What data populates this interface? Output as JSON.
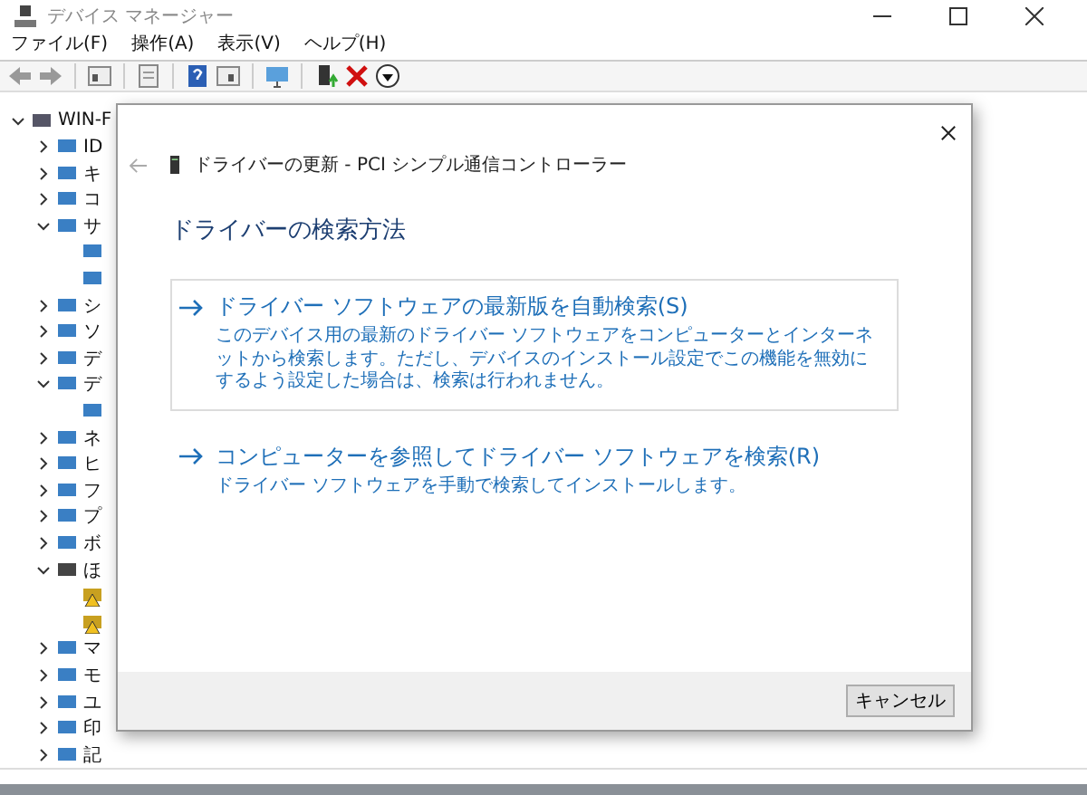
{
  "window": {
    "title": "デバイス マネージャー"
  },
  "menu": [
    "ファイル(F)",
    "操作(A)",
    "表示(V)",
    "ヘルプ(H)"
  ],
  "tree": [
    {
      "label": "WIN-F",
      "kind": "computer",
      "expanded": true,
      "children": [
        {
          "label": "ID",
          "kind": "device",
          "expanded": false
        },
        {
          "label": "キ",
          "kind": "device",
          "expanded": false
        },
        {
          "label": "コ",
          "kind": "device",
          "expanded": false
        },
        {
          "label": "サ",
          "kind": "device",
          "expanded": true,
          "children": [
            {
              "kind": "device"
            },
            {
              "kind": "device"
            }
          ]
        },
        {
          "label": "シ",
          "kind": "device",
          "expanded": false
        },
        {
          "label": "ソ",
          "kind": "device",
          "expanded": false
        },
        {
          "label": "デ",
          "kind": "device",
          "expanded": false
        },
        {
          "label": "デ",
          "kind": "device",
          "expanded": true,
          "children": [
            {
              "kind": "device"
            }
          ]
        },
        {
          "label": "ネ",
          "kind": "device",
          "expanded": false
        },
        {
          "label": "ヒ",
          "kind": "device",
          "expanded": false
        },
        {
          "label": "フ",
          "kind": "device",
          "expanded": false
        },
        {
          "label": "プ",
          "kind": "device",
          "expanded": false
        },
        {
          "label": "ボ",
          "kind": "device",
          "expanded": false
        },
        {
          "label": "ほ",
          "kind": "unknown",
          "expanded": true,
          "children": [
            {
              "kind": "warning"
            },
            {
              "kind": "warning"
            }
          ]
        },
        {
          "label": "マ",
          "kind": "device",
          "expanded": false
        },
        {
          "label": "モ",
          "kind": "device",
          "expanded": false
        },
        {
          "label": "ユ",
          "kind": "device",
          "expanded": false
        },
        {
          "label": "印",
          "kind": "device",
          "expanded": false
        },
        {
          "label": "記",
          "kind": "device",
          "expanded": false
        }
      ]
    }
  ],
  "dialog": {
    "title": "ドライバーの更新 - PCI シンプル通信コントローラー",
    "heading": "ドライバーの検索方法",
    "options": [
      {
        "title": "ドライバー ソフトウェアの最新版を自動検索(S)",
        "description": "このデバイス用の最新のドライバー ソフトウェアをコンピューターとインターネットから検索します。ただし、デバイスのインストール設定でこの機能を無効にするよう設定した場合は、検索は行われません。",
        "selected": true
      },
      {
        "title": "コンピューターを参照してドライバー ソフトウェアを検索(R)",
        "description": "ドライバー ソフトウェアを手動で検索してインストールします。",
        "selected": false
      }
    ],
    "cancel": "キャンセル"
  }
}
